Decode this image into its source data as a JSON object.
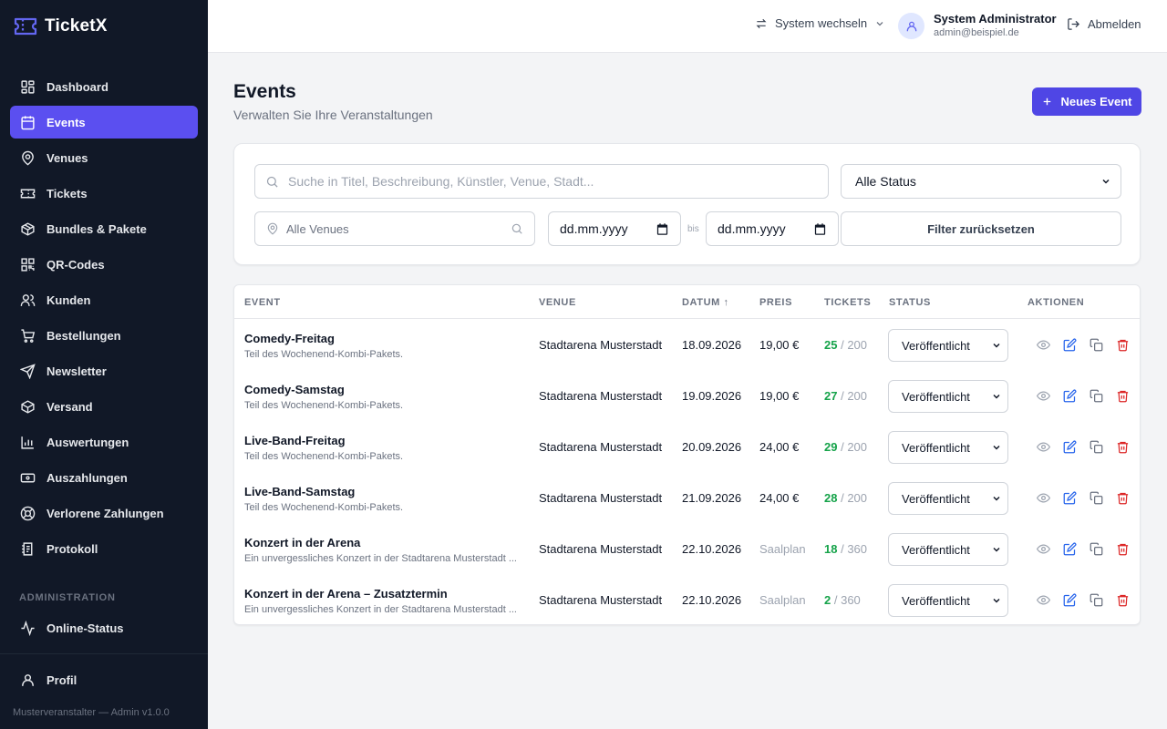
{
  "brand": {
    "name": "TicketX"
  },
  "sidebar": {
    "items": [
      {
        "label": "Dashboard",
        "icon": "dashboard-icon",
        "active": false
      },
      {
        "label": "Events",
        "icon": "calendar-icon",
        "active": true
      },
      {
        "label": "Venues",
        "icon": "map-pin-icon",
        "active": false
      },
      {
        "label": "Tickets",
        "icon": "ticket-icon",
        "active": false
      },
      {
        "label": "Bundles & Pakete",
        "icon": "package-icon",
        "active": false
      },
      {
        "label": "QR-Codes",
        "icon": "qr-code-icon",
        "active": false
      },
      {
        "label": "Kunden",
        "icon": "users-icon",
        "active": false
      },
      {
        "label": "Bestellungen",
        "icon": "cart-icon",
        "active": false
      },
      {
        "label": "Newsletter",
        "icon": "send-icon",
        "active": false
      },
      {
        "label": "Versand",
        "icon": "box-icon",
        "active": false
      },
      {
        "label": "Auswertungen",
        "icon": "chart-icon",
        "active": false
      },
      {
        "label": "Auszahlungen",
        "icon": "banknote-icon",
        "active": false
      },
      {
        "label": "Verlorene Zahlungen",
        "icon": "lifebuoy-icon",
        "active": false
      },
      {
        "label": "Protokoll",
        "icon": "log-icon",
        "active": false
      }
    ],
    "admin_section": "ADMINISTRATION",
    "admin_items": [
      {
        "label": "Online-Status",
        "icon": "activity-icon"
      }
    ],
    "profile": {
      "label": "Profil",
      "icon": "user-icon"
    },
    "footer": "Musterveranstalter — Admin v1.0.0"
  },
  "topbar": {
    "system_switch": "System wechseln",
    "user_name": "System Administrator",
    "user_email": "admin@beispiel.de",
    "logout": "Abmelden"
  },
  "page": {
    "title": "Events",
    "subtitle": "Verwalten Sie Ihre Veranstaltungen",
    "new_button": "Neues Event"
  },
  "filters": {
    "search_placeholder": "Suche in Titel, Beschreibung, Künstler, Venue, Stadt...",
    "status_value": "Alle Status",
    "venue_placeholder": "Alle Venues",
    "date_from": "dd.mm.yyyy",
    "date_sep": "bis",
    "date_to": "dd.mm.yyyy",
    "reset_button": "Filter zurücksetzen"
  },
  "table": {
    "headers": {
      "event": "EVENT",
      "venue": "VENUE",
      "date": "DATUM ↑",
      "price": "PREIS",
      "tickets": "TICKETS",
      "status": "STATUS",
      "actions": "AKTIONEN"
    },
    "rows": [
      {
        "title": "Comedy-Freitag",
        "desc": "Teil des Wochenend-Kombi-Pakets.",
        "venue": "Stadtarena Musterstadt",
        "date": "18.09.2026",
        "price": "19,00 €",
        "price_muted": false,
        "sold": "25",
        "capacity": "/ 200",
        "status": "Veröffentlicht"
      },
      {
        "title": "Comedy-Samstag",
        "desc": "Teil des Wochenend-Kombi-Pakets.",
        "venue": "Stadtarena Musterstadt",
        "date": "19.09.2026",
        "price": "19,00 €",
        "price_muted": false,
        "sold": "27",
        "capacity": "/ 200",
        "status": "Veröffentlicht"
      },
      {
        "title": "Live-Band-Freitag",
        "desc": "Teil des Wochenend-Kombi-Pakets.",
        "venue": "Stadtarena Musterstadt",
        "date": "20.09.2026",
        "price": "24,00 €",
        "price_muted": false,
        "sold": "29",
        "capacity": "/ 200",
        "status": "Veröffentlicht"
      },
      {
        "title": "Live-Band-Samstag",
        "desc": "Teil des Wochenend-Kombi-Pakets.",
        "venue": "Stadtarena Musterstadt",
        "date": "21.09.2026",
        "price": "24,00 €",
        "price_muted": false,
        "sold": "28",
        "capacity": "/ 200",
        "status": "Veröffentlicht"
      },
      {
        "title": "Konzert in der Arena",
        "desc": "Ein unvergessliches Konzert in der Stadtarena Musterstadt ...",
        "venue": "Stadtarena Musterstadt",
        "date": "22.10.2026",
        "price": "Saalplan",
        "price_muted": true,
        "sold": "18",
        "capacity": "/ 360",
        "status": "Veröffentlicht"
      },
      {
        "title": "Konzert in der Arena – Zusatztermin",
        "desc": "Ein unvergessliches Konzert in der Stadtarena Musterstadt ...",
        "venue": "Stadtarena Musterstadt",
        "date": "22.10.2026",
        "price": "Saalplan",
        "price_muted": true,
        "sold": "2",
        "capacity": "/ 360",
        "status": "Veröffentlicht"
      }
    ]
  },
  "colors": {
    "sidebar_bg": "#111827",
    "accent": "#5b4ff0",
    "primary_button": "#4f46e5",
    "sold_green": "#16a34a",
    "delete_red": "#dc2626",
    "edit_blue": "#2563eb"
  }
}
